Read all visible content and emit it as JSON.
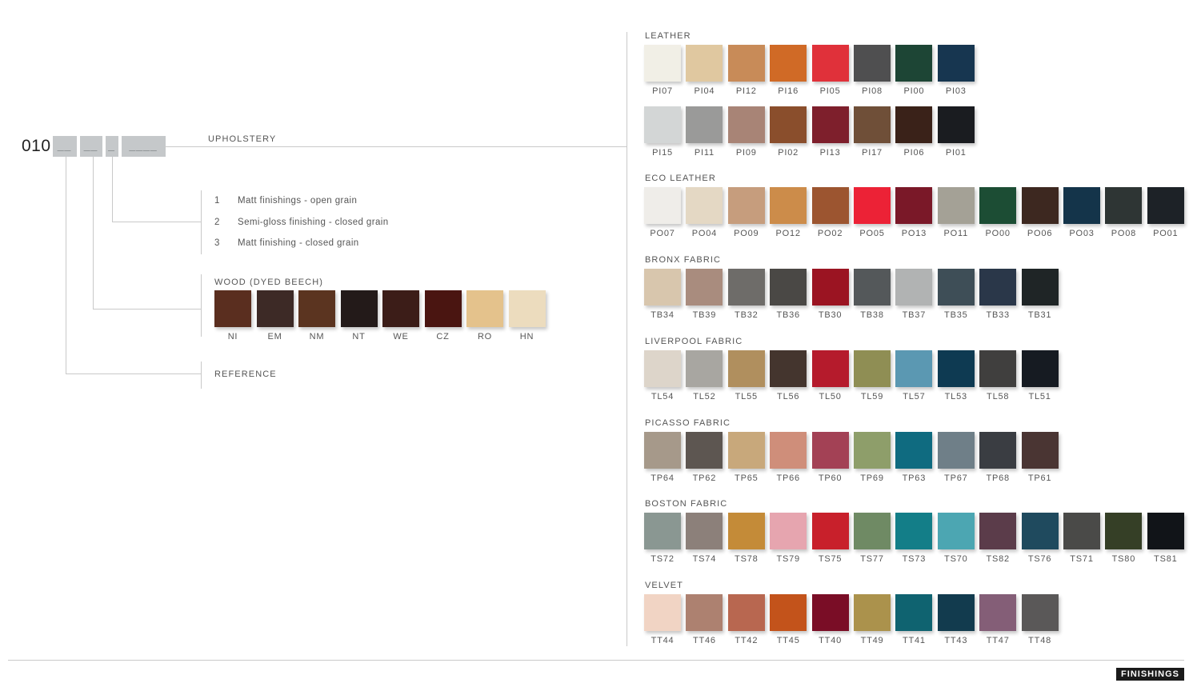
{
  "code": {
    "prefix": "010",
    "slots": [
      "__",
      "__",
      "_",
      "____"
    ]
  },
  "upholstery_label": "UPHOLSTERY",
  "finish_options": [
    {
      "num": "1",
      "text": "Matt finishings - open grain"
    },
    {
      "num": "2",
      "text": "Semi-gloss finishing - closed grain"
    },
    {
      "num": "3",
      "text": "Matt finishing - closed grain"
    }
  ],
  "wood": {
    "title": "WOOD (DYED BEECH)",
    "swatches": [
      {
        "code": "NI",
        "color": "#5a2e1f"
      },
      {
        "code": "EM",
        "color": "#3d2a26"
      },
      {
        "code": "NM",
        "color": "#5b3420"
      },
      {
        "code": "NT",
        "color": "#231a19"
      },
      {
        "code": "WE",
        "color": "#3c1d18"
      },
      {
        "code": "CZ",
        "color": "#4a1511"
      },
      {
        "code": "RO",
        "color": "#e4c28c"
      },
      {
        "code": "HN",
        "color": "#ecdcbe"
      }
    ]
  },
  "reference_label": "REFERENCE",
  "groups": [
    {
      "title": "LEATHER",
      "rows": [
        [
          {
            "code": "PI07",
            "color": "#f1efe6"
          },
          {
            "code": "PI04",
            "color": "#e0c8a0"
          },
          {
            "code": "PI12",
            "color": "#c88b58"
          },
          {
            "code": "PI16",
            "color": "#d06a26"
          },
          {
            "code": "PI05",
            "color": "#e0313a"
          },
          {
            "code": "PI08",
            "color": "#4f4f50"
          },
          {
            "code": "PI00",
            "color": "#1d4535"
          },
          {
            "code": "PI03",
            "color": "#173650"
          }
        ],
        [
          {
            "code": "PI15",
            "color": "#d3d6d6"
          },
          {
            "code": "PI11",
            "color": "#9a9a99"
          },
          {
            "code": "PI09",
            "color": "#a88476"
          },
          {
            "code": "PI02",
            "color": "#8a4e2c"
          },
          {
            "code": "PI13",
            "color": "#7e1f2c"
          },
          {
            "code": "PI17",
            "color": "#6f4f38"
          },
          {
            "code": "PI06",
            "color": "#3a2219"
          },
          {
            "code": "PI01",
            "color": "#1a1c20"
          }
        ]
      ]
    },
    {
      "title": "ECO LEATHER",
      "rows": [
        [
          {
            "code": "PO07",
            "color": "#efede9"
          },
          {
            "code": "PO04",
            "color": "#e4d8c4"
          },
          {
            "code": "PO09",
            "color": "#c69d7d"
          },
          {
            "code": "PO12",
            "color": "#cc8c4a"
          },
          {
            "code": "PO02",
            "color": "#9c5530"
          },
          {
            "code": "PO05",
            "color": "#ec2236"
          },
          {
            "code": "PO13",
            "color": "#7a1828"
          },
          {
            "code": "PO11",
            "color": "#a4a196"
          },
          {
            "code": "PO00",
            "color": "#1c4d34"
          },
          {
            "code": "PO06",
            "color": "#3d2820"
          },
          {
            "code": "PO03",
            "color": "#14344a"
          },
          {
            "code": "PO08",
            "color": "#2e3534"
          },
          {
            "code": "PO01",
            "color": "#1d2227"
          }
        ]
      ]
    },
    {
      "title": "BRONX FABRIC",
      "rows": [
        [
          {
            "code": "TB34",
            "color": "#d8c6ad"
          },
          {
            "code": "TB39",
            "color": "#a98c7e"
          },
          {
            "code": "TB32",
            "color": "#6e6c69"
          },
          {
            "code": "TB36",
            "color": "#4a4845"
          },
          {
            "code": "TB30",
            "color": "#9b1422"
          },
          {
            "code": "TB38",
            "color": "#54585a"
          },
          {
            "code": "TB37",
            "color": "#b1b3b3"
          },
          {
            "code": "TB35",
            "color": "#3e4e57"
          },
          {
            "code": "TB33",
            "color": "#2a3749"
          },
          {
            "code": "TB31",
            "color": "#1f2526"
          }
        ]
      ]
    },
    {
      "title": "LIVERPOOL FABRIC",
      "rows": [
        [
          {
            "code": "TL54",
            "color": "#ddd5ca"
          },
          {
            "code": "TL52",
            "color": "#a8a6a1"
          },
          {
            "code": "TL55",
            "color": "#b08f5e"
          },
          {
            "code": "TL56",
            "color": "#44352e"
          },
          {
            "code": "TL50",
            "color": "#b51b2c"
          },
          {
            "code": "TL59",
            "color": "#8f8e54"
          },
          {
            "code": "TL57",
            "color": "#5b98b2"
          },
          {
            "code": "TL53",
            "color": "#0e3a52"
          },
          {
            "code": "TL58",
            "color": "#403f3e"
          },
          {
            "code": "TL51",
            "color": "#161b22"
          }
        ]
      ]
    },
    {
      "title": "PICASSO FABRIC",
      "rows": [
        [
          {
            "code": "TP64",
            "color": "#a6998a"
          },
          {
            "code": "TP62",
            "color": "#5d5651"
          },
          {
            "code": "TP65",
            "color": "#c8a87b"
          },
          {
            "code": "TP66",
            "color": "#cf8e7a"
          },
          {
            "code": "TP60",
            "color": "#a34155"
          },
          {
            "code": "TP69",
            "color": "#8e9e6a"
          },
          {
            "code": "TP63",
            "color": "#0f6b80"
          },
          {
            "code": "TP67",
            "color": "#6f7f88"
          },
          {
            "code": "TP68",
            "color": "#3a3d42"
          },
          {
            "code": "TP61",
            "color": "#4a3533"
          }
        ]
      ]
    },
    {
      "title": "BOSTON FABRIC",
      "rows": [
        [
          {
            "code": "TS72",
            "color": "#8a9792"
          },
          {
            "code": "TS74",
            "color": "#8c807a"
          },
          {
            "code": "TS78",
            "color": "#c48b38"
          },
          {
            "code": "TS79",
            "color": "#e6a5af"
          },
          {
            "code": "TS75",
            "color": "#c8202b"
          },
          {
            "code": "TS77",
            "color": "#6f8a64"
          },
          {
            "code": "TS73",
            "color": "#137e88"
          },
          {
            "code": "TS70",
            "color": "#4ca6b2"
          },
          {
            "code": "TS82",
            "color": "#5b3c4a"
          },
          {
            "code": "TS76",
            "color": "#1f4a5e"
          },
          {
            "code": "TS71",
            "color": "#4a4a48"
          },
          {
            "code": "TS80",
            "color": "#353f26"
          },
          {
            "code": "TS81",
            "color": "#111418"
          }
        ]
      ]
    },
    {
      "title": "VELVET",
      "rows": [
        [
          {
            "code": "TT44",
            "color": "#f1d4c4"
          },
          {
            "code": "TT46",
            "color": "#ad8170"
          },
          {
            "code": "TT42",
            "color": "#b86750"
          },
          {
            "code": "TT45",
            "color": "#c3531b"
          },
          {
            "code": "TT40",
            "color": "#7a0d26"
          },
          {
            "code": "TT49",
            "color": "#ab924c"
          },
          {
            "code": "TT41",
            "color": "#0f6370"
          },
          {
            "code": "TT43",
            "color": "#123b4e"
          },
          {
            "code": "TT47",
            "color": "#845e77"
          },
          {
            "code": "TT48",
            "color": "#5a5858"
          }
        ]
      ]
    }
  ],
  "footer_badge": "FINISHINGS"
}
